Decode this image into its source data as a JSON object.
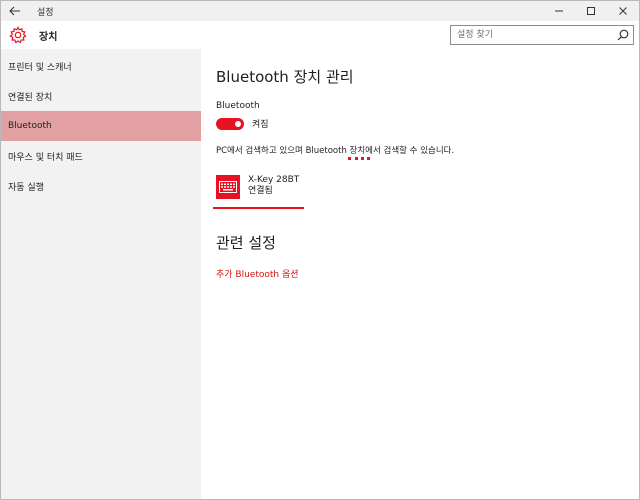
{
  "window": {
    "title": "설정"
  },
  "header": {
    "heading": "장치",
    "search_placeholder": "설정 찾기"
  },
  "sidebar": {
    "items": [
      {
        "label": "프린터 및 스캐너"
      },
      {
        "label": "연결된 장치"
      },
      {
        "label": "Bluetooth",
        "active": true
      },
      {
        "label": "마우스 및 터치 패드"
      },
      {
        "label": "자동 실행"
      }
    ]
  },
  "main": {
    "title": "Bluetooth 장치 관리",
    "bluetooth_label": "Bluetooth",
    "toggle_state": "켜짐",
    "info_before": "PC에서 검색하고 있으며 ",
    "info_bt": "Bluetooth",
    "info_after": " 장치에서 검색할 수 있습니다.",
    "device": {
      "name": "X-Key 28BT",
      "status": "연결됨",
      "icon": "keyboard-icon"
    },
    "related_title": "관련 설정",
    "related_link": "추가 Bluetooth 옵션"
  },
  "colors": {
    "accent": "#e81123",
    "sidebar_active": "#e2a0a2",
    "link": "#d01414"
  }
}
